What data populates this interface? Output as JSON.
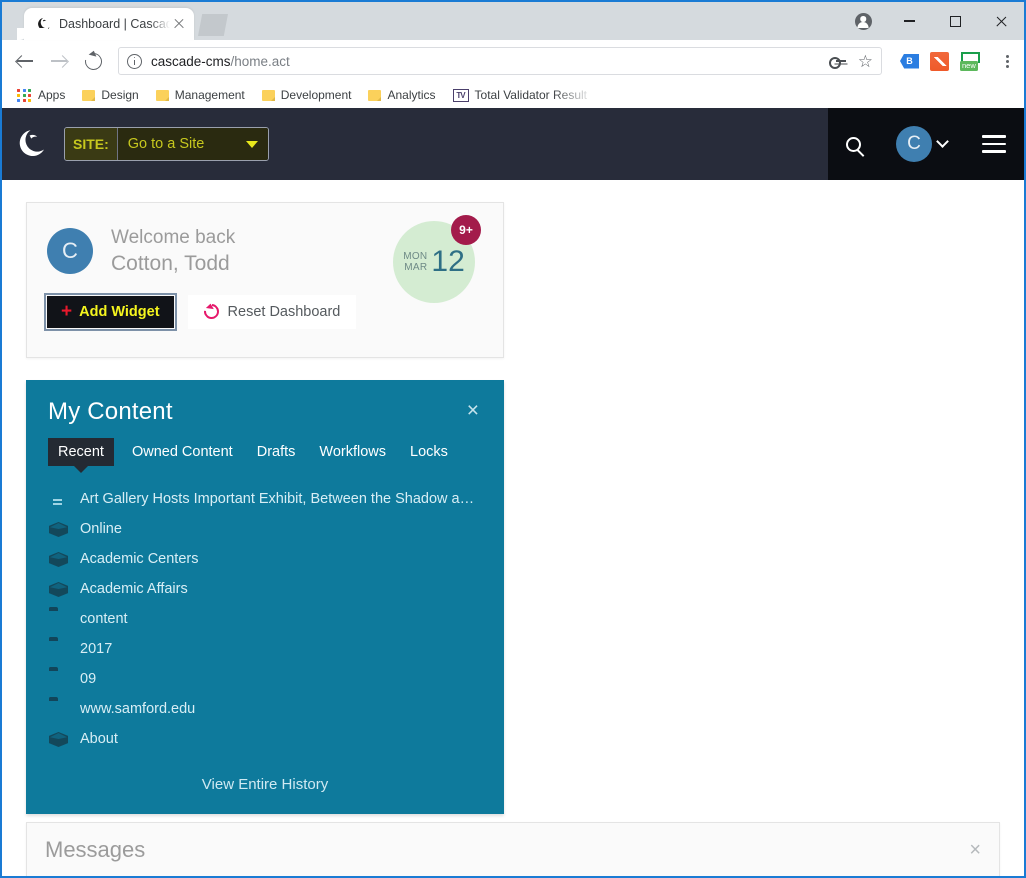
{
  "browser": {
    "tab": {
      "title": "Dashboard | Cascade CMS",
      "favicon": "cascade-logo-icon",
      "close_icon": "close-icon",
      "new_tab_icon": "new-tab-icon"
    },
    "window_controls": {
      "profile_icon": "profile-icon",
      "minimize_icon": "minimize-icon",
      "maximize_icon": "maximize-icon",
      "close_icon": "window-close-icon"
    },
    "toolbar": {
      "back_icon": "back-arrow-icon",
      "forward_icon": "forward-arrow-icon",
      "reload_icon": "reload-icon",
      "info_icon": "page-info-icon",
      "url": "cascade-cms/home.act",
      "url_host": "cascade-cms",
      "url_path": "/home.act",
      "key_icon": "password-key-icon",
      "star_icon": "★",
      "star_name": "bookmark-star-icon",
      "extensions": [
        {
          "name": "tag-extension-icon",
          "glyph": "B"
        },
        {
          "name": "chart-extension-icon",
          "glyph": ""
        },
        {
          "name": "new-extension-icon",
          "badge": "new"
        }
      ],
      "menu_icon": "browser-menu-icon"
    },
    "bookmarks": [
      {
        "label": "Apps",
        "icon": "apps-grid-icon"
      },
      {
        "label": "Design",
        "icon": "folder-icon"
      },
      {
        "label": "Management",
        "icon": "folder-icon"
      },
      {
        "label": "Development",
        "icon": "folder-icon"
      },
      {
        "label": "Analytics",
        "icon": "folder-icon"
      },
      {
        "label": "Total Validator Result",
        "icon": "total-validator-icon",
        "icon_glyph": "TV"
      }
    ]
  },
  "app": {
    "header": {
      "logo": "cascade-cms-logo",
      "site_label": "SITE:",
      "site_value": "Go to a Site",
      "site_caret_icon": "chevron-down-icon",
      "search_icon": "search-icon",
      "user_initial": "C",
      "user_caret_icon": "chevron-down-icon",
      "menu_icon": "hamburger-menu-icon"
    },
    "welcome": {
      "avatar_initial": "C",
      "greeting": "Welcome back",
      "user_name": "Cotton, Todd",
      "date": {
        "day_of_week": "MON",
        "month": "MAR",
        "day": "12",
        "badge": "9+"
      },
      "add_widget_label": "Add Widget",
      "add_widget_icon": "plus-icon",
      "reset_label": "Reset Dashboard",
      "reset_icon": "refresh-icon"
    },
    "my_content": {
      "title": "My Content",
      "close_icon": "×",
      "tabs": [
        {
          "label": "Recent",
          "active": true
        },
        {
          "label": "Owned Content",
          "active": false
        },
        {
          "label": "Drafts",
          "active": false
        },
        {
          "label": "Workflows",
          "active": false
        },
        {
          "label": "Locks",
          "active": false
        }
      ],
      "items": [
        {
          "label": "Art Gallery Hosts Important Exhibit, Between the Shadow and…",
          "icon": "page-icon"
        },
        {
          "label": "Online",
          "icon": "block-icon"
        },
        {
          "label": "Academic Centers",
          "icon": "block-icon"
        },
        {
          "label": "Academic Affairs",
          "icon": "block-icon"
        },
        {
          "label": "content",
          "icon": "folder-icon"
        },
        {
          "label": "2017",
          "icon": "folder-icon"
        },
        {
          "label": "09",
          "icon": "folder-icon"
        },
        {
          "label": "www.samford.edu",
          "icon": "folder-icon"
        },
        {
          "label": "About",
          "icon": "block-icon"
        }
      ],
      "history_link": "View Entire History"
    },
    "messages": {
      "title": "Messages",
      "close_icon": "×"
    }
  },
  "colors": {
    "header_dark": "#282c3a",
    "header_right_dark": "#0b0d12",
    "widget_teal": "#0e7a9c",
    "accent_yellow": "#e8e81c",
    "badge_crimson": "#a31b4b",
    "date_green": "#d4ecd2",
    "avatar_blue": "#3f7fb0"
  }
}
